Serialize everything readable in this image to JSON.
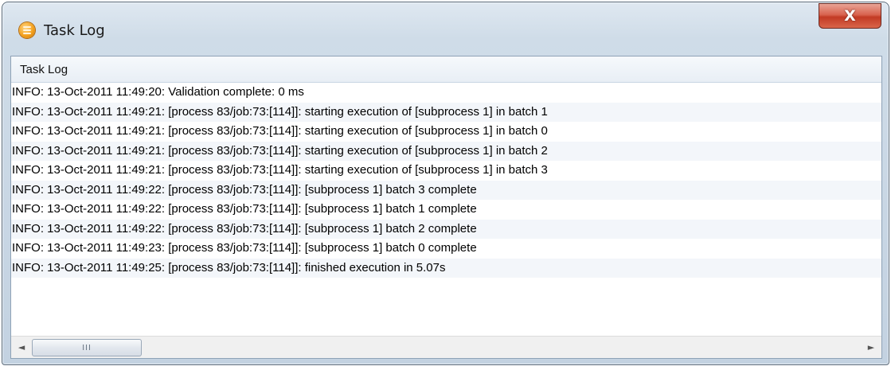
{
  "window": {
    "title": "Task Log",
    "app_icon": "list-bullets-icon",
    "close_label": "X"
  },
  "panel": {
    "header": "Task Log"
  },
  "log": [
    "INFO: 13-Oct-2011 11:49:20: Validation complete: 0 ms",
    "INFO: 13-Oct-2011 11:49:21: [process 83/job:73:[114]]: starting execution of [subprocess 1] in batch 1",
    "INFO: 13-Oct-2011 11:49:21: [process 83/job:73:[114]]: starting execution of [subprocess 1] in batch 0",
    "INFO: 13-Oct-2011 11:49:21: [process 83/job:73:[114]]: starting execution of [subprocess 1] in batch 2",
    "INFO: 13-Oct-2011 11:49:21: [process 83/job:73:[114]]: starting execution of [subprocess 1] in batch 3",
    "INFO: 13-Oct-2011 11:49:22: [process 83/job:73:[114]]: [subprocess 1] batch 3 complete",
    "INFO: 13-Oct-2011 11:49:22: [process 83/job:73:[114]]: [subprocess 1] batch 1 complete",
    "INFO: 13-Oct-2011 11:49:22: [process 83/job:73:[114]]: [subprocess 1] batch 2 complete",
    "INFO: 13-Oct-2011 11:49:23: [process 83/job:73:[114]]: [subprocess 1] batch 0 complete",
    "INFO: 13-Oct-2011 11:49:25: [process 83/job:73:[114]]: finished execution in 5.07s"
  ],
  "scrollbar": {
    "left_arrow": "◄",
    "right_arrow": "►",
    "thumb_grip": "III"
  }
}
